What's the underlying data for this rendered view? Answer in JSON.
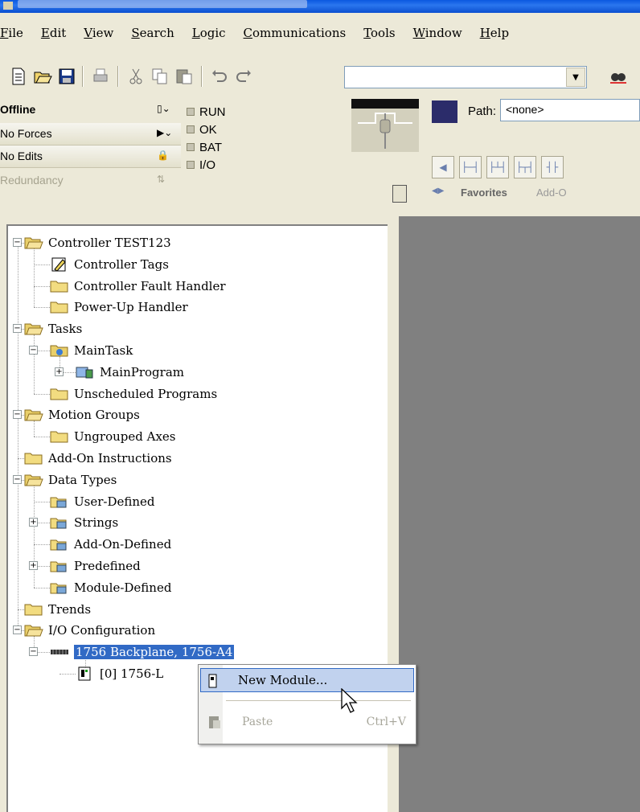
{
  "menu": [
    "File",
    "Edit",
    "View",
    "Search",
    "Logic",
    "Communications",
    "Tools",
    "Window",
    "Help"
  ],
  "menu_underline": [
    "F",
    "E",
    "V",
    "S",
    "L",
    "C",
    "T",
    "W",
    "H"
  ],
  "toolbar": {
    "icons": [
      "new-file-icon",
      "open-folder-icon",
      "save-icon",
      "print-icon",
      "cut-icon",
      "copy-icon",
      "paste-icon",
      "undo-icon",
      "redo-icon",
      "find-icon"
    ],
    "combo_value": ""
  },
  "status": {
    "offline": "Offline",
    "forces": "No Forces",
    "edits": "No Edits",
    "redundancy": "Redundancy"
  },
  "leds": [
    "RUN",
    "OK",
    "BAT",
    "I/O"
  ],
  "path": {
    "label": "Path:",
    "value": "<none>"
  },
  "tabs": {
    "favorites": "Favorites",
    "addon": "Add-O"
  },
  "tree": [
    {
      "label": "Controller TEST123",
      "icon": "folder-open-icon"
    },
    {
      "label": "Controller Tags",
      "icon": "tags-icon"
    },
    {
      "label": "Controller Fault Handler",
      "icon": "folder-icon"
    },
    {
      "label": "Power-Up Handler",
      "icon": "folder-icon"
    },
    {
      "label": "Tasks",
      "icon": "folder-open-icon"
    },
    {
      "label": "MainTask",
      "icon": "task-icon"
    },
    {
      "label": "MainProgram",
      "icon": "program-icon"
    },
    {
      "label": "Unscheduled Programs",
      "icon": "folder-icon"
    },
    {
      "label": "Motion Groups",
      "icon": "folder-open-icon"
    },
    {
      "label": "Ungrouped Axes",
      "icon": "folder-icon"
    },
    {
      "label": "Add-On Instructions",
      "icon": "folder-icon"
    },
    {
      "label": "Data Types",
      "icon": "folder-open-icon"
    },
    {
      "label": "User-Defined",
      "icon": "datatype-icon"
    },
    {
      "label": "Strings",
      "icon": "datatype-icon"
    },
    {
      "label": "Add-On-Defined",
      "icon": "datatype-icon"
    },
    {
      "label": "Predefined",
      "icon": "datatype-icon"
    },
    {
      "label": "Module-Defined",
      "icon": "datatype-icon"
    },
    {
      "label": "Trends",
      "icon": "folder-icon"
    },
    {
      "label": "I/O Configuration",
      "icon": "folder-open-icon"
    },
    {
      "label": "1756 Backplane, 1756-A4",
      "icon": "backplane-icon"
    },
    {
      "label": "[0] 1756-L",
      "icon": "module-icon"
    }
  ],
  "context_menu": {
    "new_module": "New Module...",
    "paste": "Paste",
    "paste_shortcut": "Ctrl+V"
  }
}
